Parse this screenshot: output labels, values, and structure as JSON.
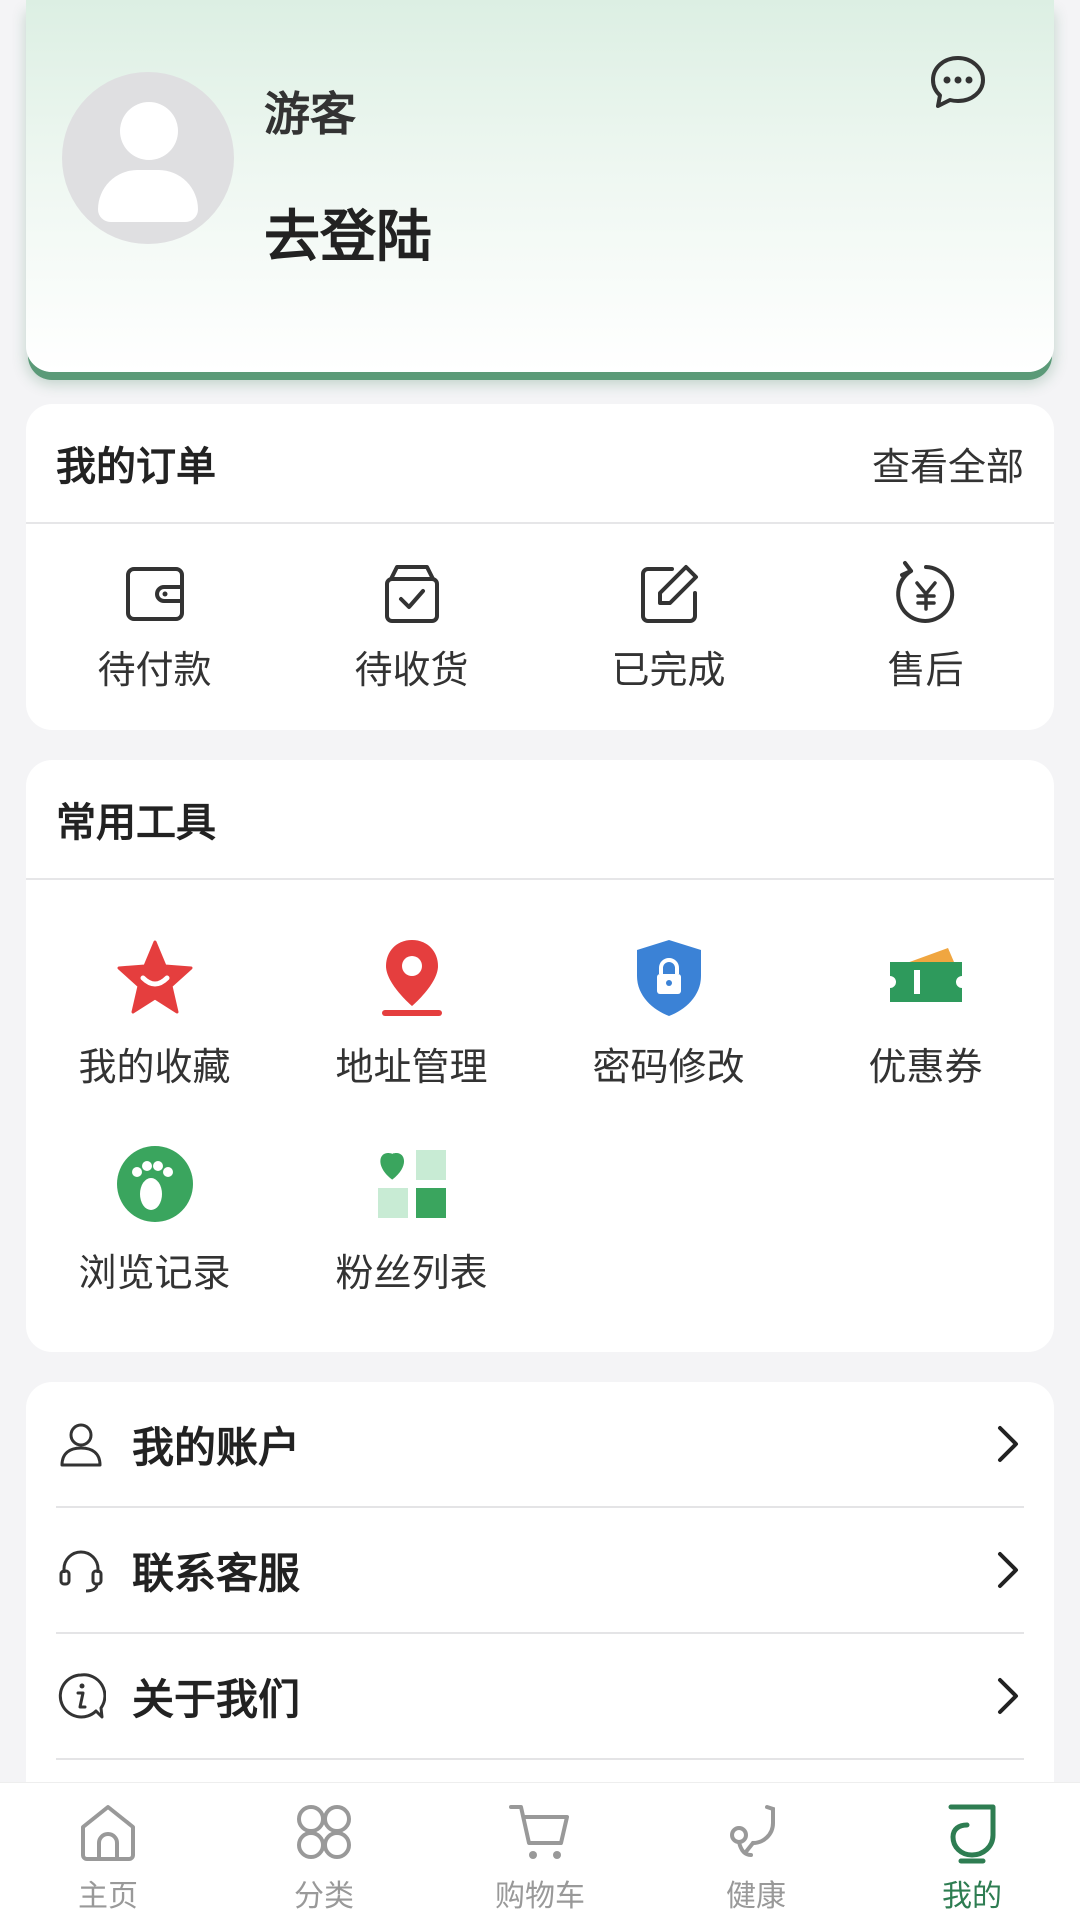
{
  "profile": {
    "guest_name": "游客",
    "login_label": "去登陆",
    "message_icon": "chat-bubble-icon"
  },
  "orders": {
    "title": "我的订单",
    "view_all": "查看全部",
    "items": [
      {
        "label": "待付款",
        "icon": "wallet-icon"
      },
      {
        "label": "待收货",
        "icon": "package-check-icon"
      },
      {
        "label": "已完成",
        "icon": "edit-icon"
      },
      {
        "label": "售后",
        "icon": "yuan-refund-icon"
      }
    ]
  },
  "tools": {
    "title": "常用工具",
    "items": [
      {
        "label": "我的收藏",
        "icon": "star-icon",
        "color": "#e53e3e"
      },
      {
        "label": "地址管理",
        "icon": "location-pin-icon",
        "color": "#e53e3e"
      },
      {
        "label": "密码修改",
        "icon": "shield-lock-icon",
        "color": "#3b82d6"
      },
      {
        "label": "优惠券",
        "icon": "coupon-icon",
        "color": "#2e9a5c"
      },
      {
        "label": "浏览记录",
        "icon": "footprint-icon",
        "color": "#3aa55e"
      },
      {
        "label": "粉丝列表",
        "icon": "heart-grid-icon",
        "color": "#3aa55e"
      }
    ]
  },
  "menu": {
    "items": [
      {
        "label": "我的账户",
        "icon": "user-icon"
      },
      {
        "label": "联系客服",
        "icon": "headset-icon"
      },
      {
        "label": "关于我们",
        "icon": "info-icon"
      }
    ]
  },
  "tabbar": {
    "active_color": "#2e7d52",
    "items": [
      {
        "label": "主页",
        "icon": "home-icon"
      },
      {
        "label": "分类",
        "icon": "grid-icon"
      },
      {
        "label": "购物车",
        "icon": "cart-icon"
      },
      {
        "label": "健康",
        "icon": "stethoscope-icon"
      },
      {
        "label": "我的",
        "icon": "profile-icon",
        "active": true
      }
    ]
  }
}
